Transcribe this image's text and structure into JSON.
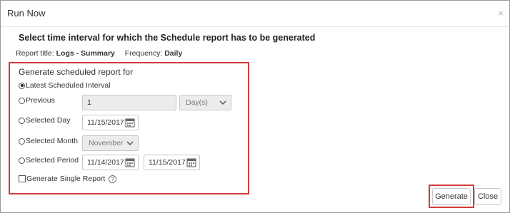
{
  "dialog": {
    "title": "Run Now",
    "close_glyph": "×",
    "instruction": "Select time interval for which the Schedule report has to be generated",
    "report_title_label": "Report title:",
    "report_title_value": "Logs - Summary",
    "frequency_label": "Frequency:",
    "frequency_value": "Daily"
  },
  "options": {
    "section_label": "Generate scheduled report for",
    "latest": "Latest Scheduled Interval",
    "previous": "Previous",
    "previous_value": "1",
    "previous_unit": "Day(s)",
    "selected_day": "Selected Day",
    "day_value": "11/15/2017",
    "selected_month": "Selected Month",
    "month_value": "November",
    "selected_period": "Selected Period",
    "period_start": "11/14/2017",
    "period_end": "11/15/2017",
    "single_report": "Generate Single Report",
    "help_glyph": "?",
    "selected_option": "latest"
  },
  "footer": {
    "generate": "Generate",
    "close": "Close"
  },
  "colors": {
    "highlight": "#d33d3d",
    "border": "#c8c8c8",
    "disabled_bg": "#ececec"
  },
  "icons": {
    "calendar": "calendar-icon",
    "chevron": "chevron-down-icon",
    "help": "help-icon",
    "close": "close-icon"
  }
}
